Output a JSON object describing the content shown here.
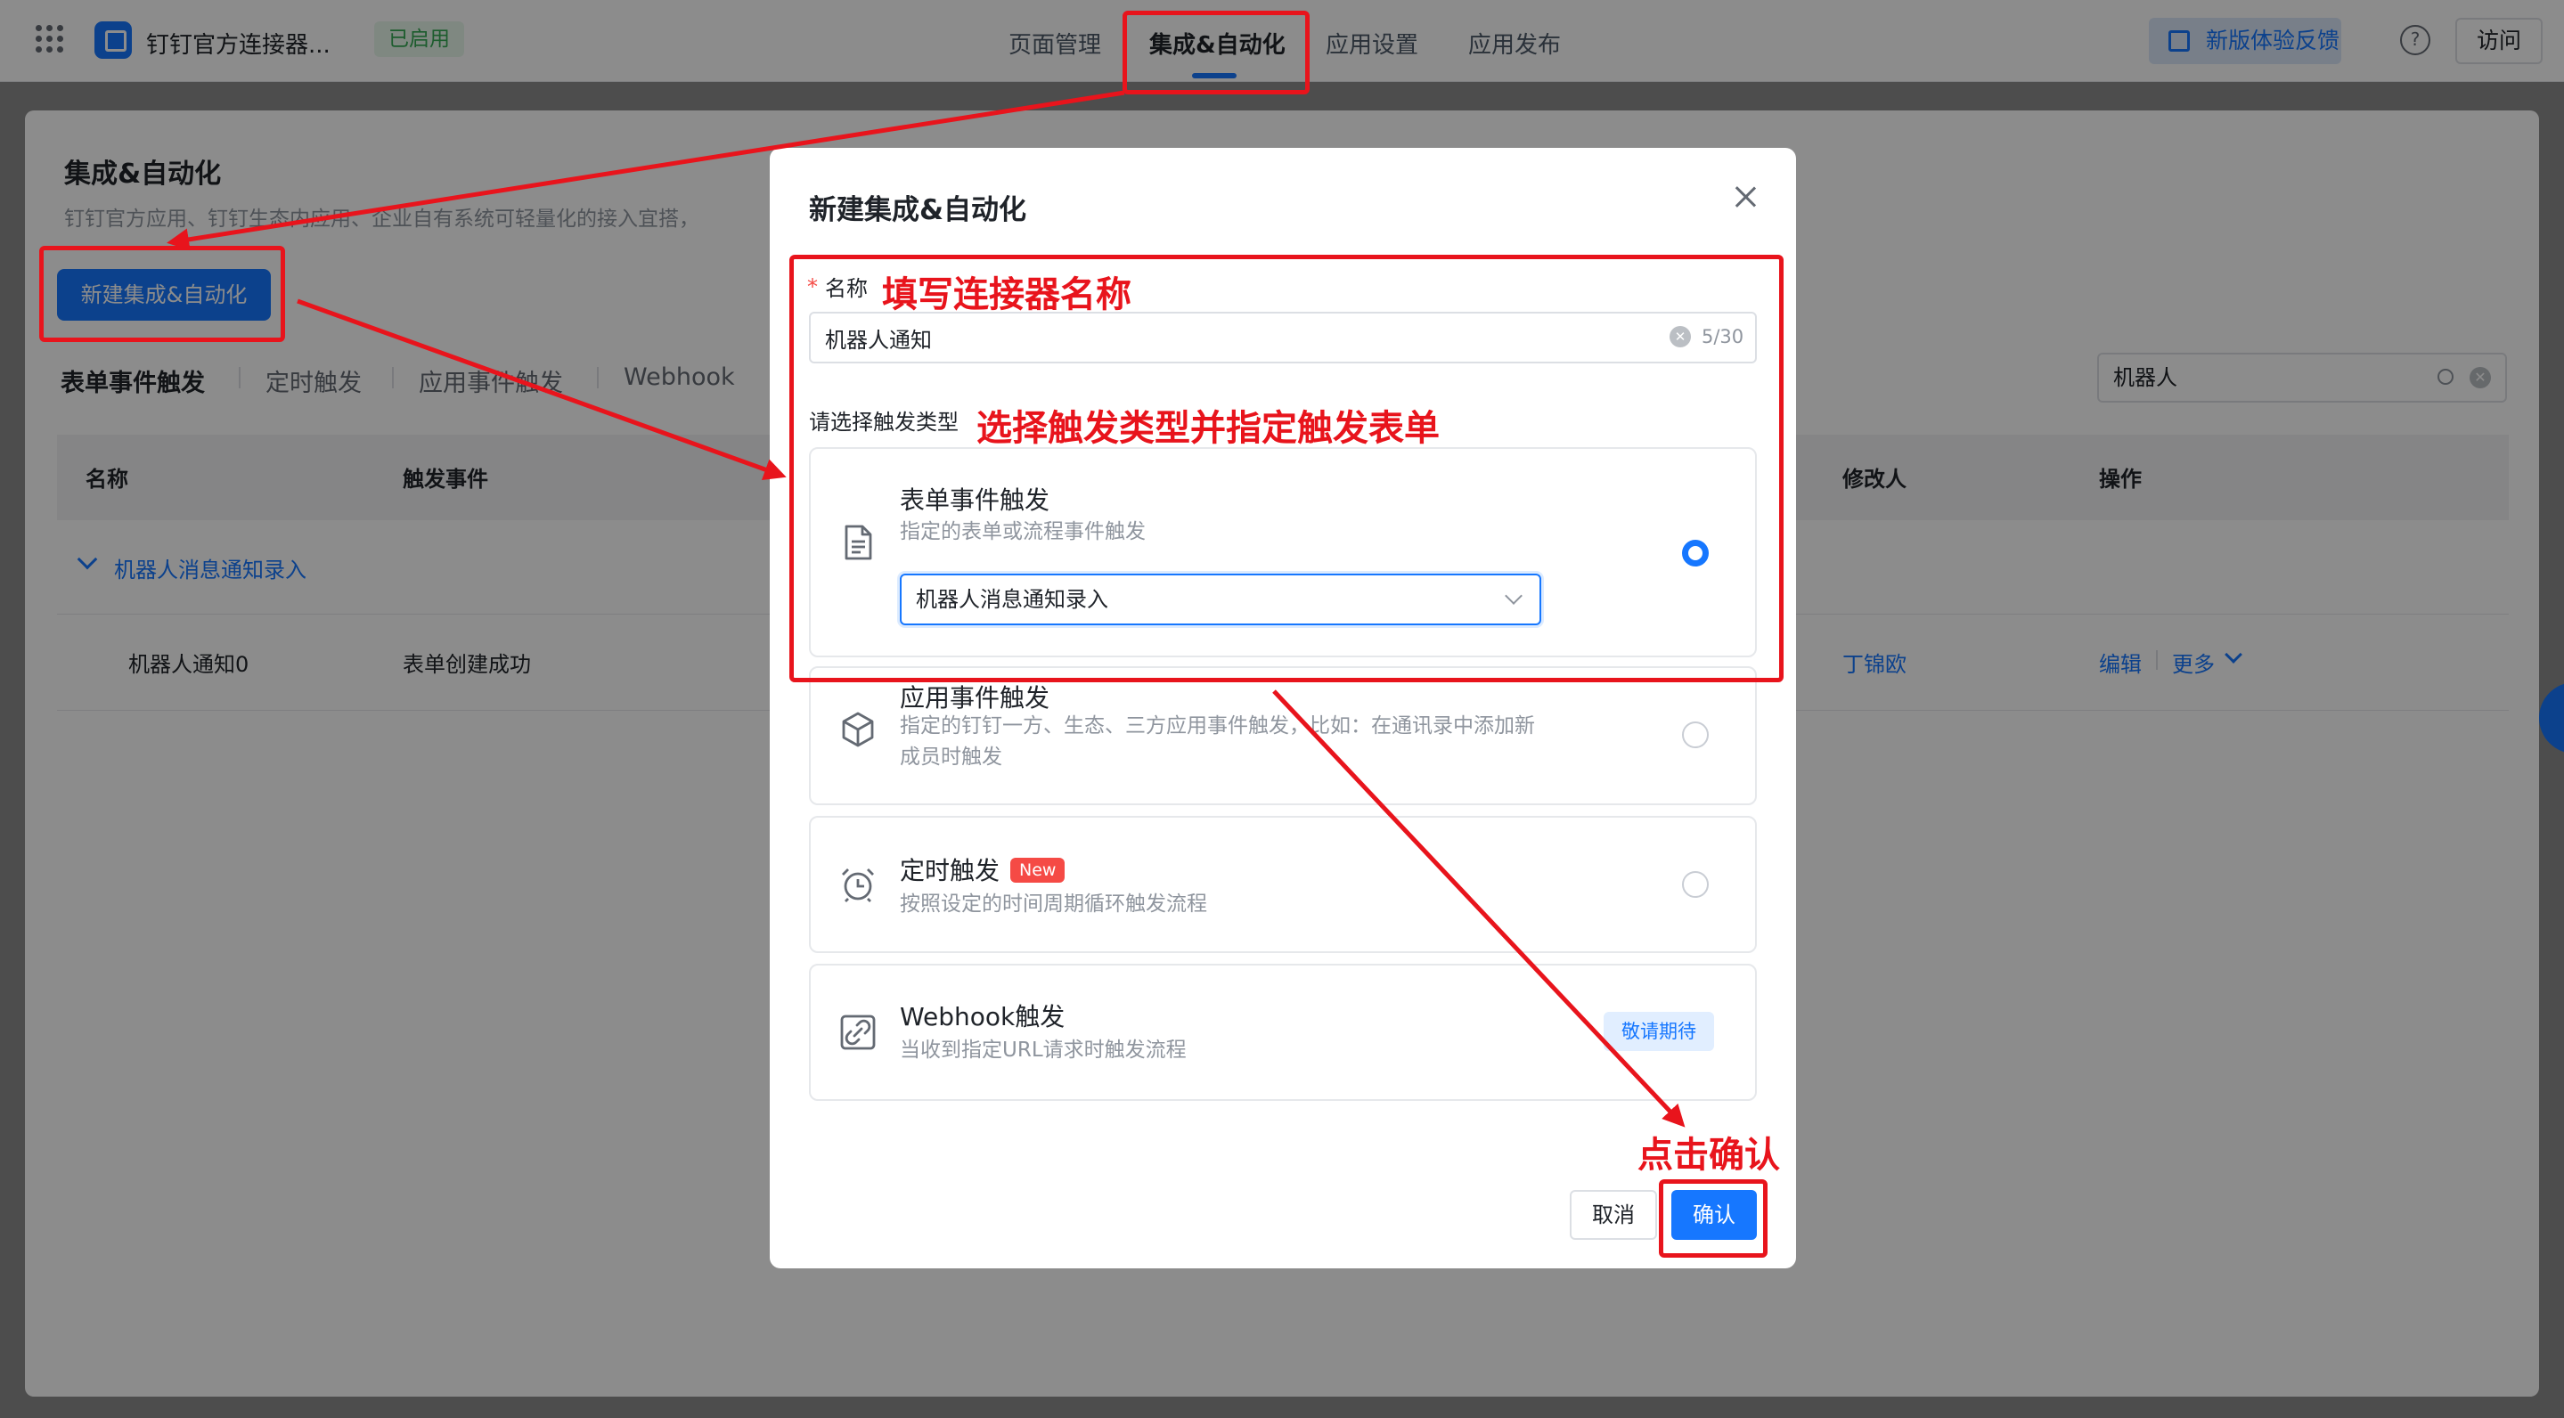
{
  "topbar": {
    "app_name": "钉钉官方连接器...",
    "status": "已启用",
    "tabs": [
      "页面管理",
      "集成&自动化",
      "应用设置",
      "应用发布"
    ],
    "feedback": "新版体验反馈",
    "help": "?",
    "visit": "访问"
  },
  "page": {
    "title": "集成&自动化",
    "desc": "钉钉官方应用、钉钉生态内应用、企业自有系统可轻量化的接入宜搭，",
    "new_button": "新建集成&自动化",
    "subtabs": [
      "表单事件触发",
      "定时触发",
      "应用事件触发",
      "Webhook"
    ],
    "search_value": "机器人"
  },
  "table": {
    "headers": [
      "名称",
      "触发事件",
      "修改人",
      "操作"
    ],
    "group": "机器人消息通知录入",
    "row": {
      "name": "机器人通知0",
      "event": "表单创建成功",
      "modifier": "丁锦欧",
      "edit": "编辑",
      "more": "更多"
    }
  },
  "modal": {
    "title": "新建集成&自动化",
    "required_mark": "*",
    "name_label": "名称",
    "name_value": "机器人通知",
    "name_count": "5/30",
    "type_label": "请选择触发类型",
    "options": [
      {
        "title": "表单事件触发",
        "desc": "指定的表单或流程事件触发",
        "select_value": "机器人消息通知录入"
      },
      {
        "title": "应用事件触发",
        "desc": "指定的钉钉一方、生态、三方应用事件触发，比如：在通讯录中添加新成员时触发"
      },
      {
        "title": "定时触发",
        "tag": "New",
        "desc": "按照设定的时间周期循环触发流程"
      },
      {
        "title": "Webhook触发",
        "desc": "当收到指定URL请求时触发流程",
        "tag": "敬请期待"
      }
    ],
    "cancel": "取消",
    "confirm": "确认"
  },
  "annotations": {
    "name_hint": "填写连接器名称",
    "type_hint": "选择触发类型并指定触发表单",
    "confirm_hint": "点击确认",
    "color": "#e8141c"
  },
  "colors": {
    "primary": "#1677ff",
    "annotation": "#e8141c"
  }
}
